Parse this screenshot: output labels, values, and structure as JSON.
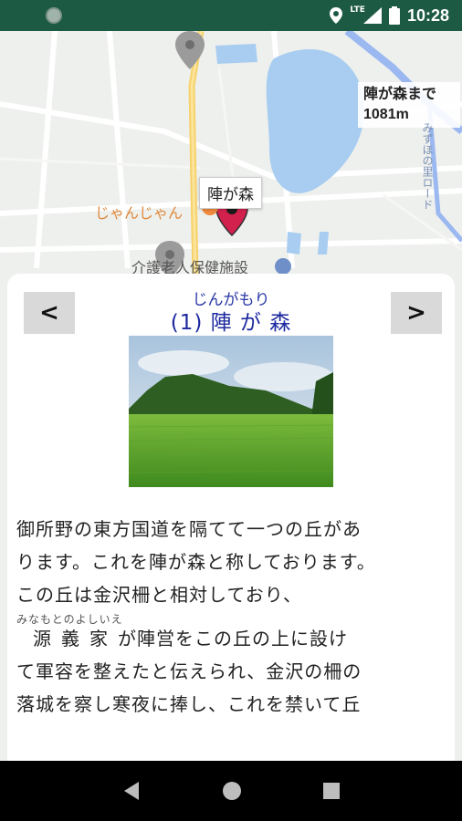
{
  "status_bar": {
    "time": "10:28",
    "network": "LTE"
  },
  "map": {
    "distance_label": "陣が森まで\n1081m",
    "selected_marker_label": "陣が森",
    "place_labels": [
      "じゃんじゃん",
      "介護老人保健施設"
    ],
    "road_label": "みずほの里ロード"
  },
  "panel": {
    "prev_label": "<",
    "next_label": ">",
    "title_ruby": "じんがもり",
    "title": "(1) 陣 が 森",
    "body_lines": [
      "御所野の東方国道を隔てて一つの丘があ",
      "ります。これを陣が森と称しております。",
      "この丘は金沢柵と相対しており、"
    ],
    "ruby_name": "みなもとのよしいえ",
    "name_text": "源義家",
    "line4_rest": "が陣営をこの丘の上に設け",
    "body_lines_after": [
      "て軍容を整えたと伝えられ、金沢の柵の",
      "落城を察し寒夜に捧し、これを禁いて丘"
    ]
  },
  "colors": {
    "status_bar": "#1d5a44",
    "title": "#1d2aa0",
    "marker": "#d2214d"
  }
}
